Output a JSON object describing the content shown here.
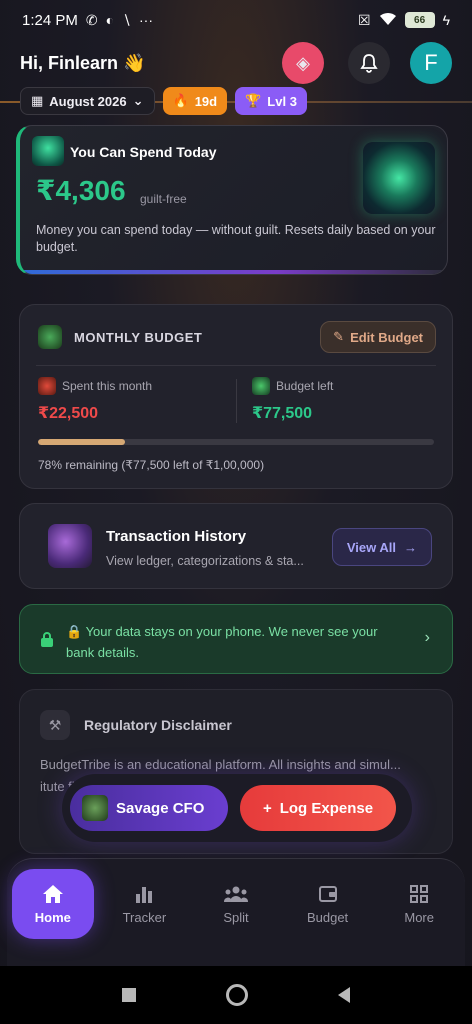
{
  "status_bar": {
    "time": "1:24 PM",
    "battery": "66"
  },
  "header": {
    "greeting": "Hi, Finlearn 👋",
    "avatar_letter": "F"
  },
  "chips": {
    "month": "August 2026",
    "streak": "19d",
    "level": "Lvl 3"
  },
  "spend_today": {
    "title": "You Can Spend Today",
    "amount": "₹4,306",
    "suffix": "guilt-free",
    "description": "Money you can spend today — without guilt. Resets daily based on your budget."
  },
  "monthly_budget": {
    "title": "MONTHLY BUDGET",
    "edit_label": "Edit Budget",
    "spent_label": "Spent this month",
    "spent_value": "₹22,500",
    "left_label": "Budget left",
    "left_value": "₹77,500",
    "spent_fraction": 0.22,
    "note": "78% remaining (₹77,500 left of ₹1,00,000)"
  },
  "transactions": {
    "title": "Transaction History",
    "subtitle": "View ledger, categorizations & sta...",
    "view_all": "View All"
  },
  "privacy": {
    "text": "🔒 Your data stays on your phone. We never see your bank details."
  },
  "disclaimer": {
    "title": "Regulatory Disclaimer",
    "body": "BudgetTribe is an educational platform. All insights and simul... itute fina... cons..."
  },
  "fab": {
    "cfo_label": "Savage CFO",
    "log_label": "Log Expense"
  },
  "bottom_nav": {
    "items": [
      {
        "label": "Home",
        "icon": "home-icon"
      },
      {
        "label": "Tracker",
        "icon": "bar-chart-icon"
      },
      {
        "label": "Split",
        "icon": "group-icon"
      },
      {
        "label": "Budget",
        "icon": "wallet-icon"
      },
      {
        "label": "More",
        "icon": "grid-icon"
      }
    ]
  },
  "colors": {
    "accent_purple": "#7a4cf0",
    "green": "#2cc88a",
    "red": "#ef4a4a"
  }
}
